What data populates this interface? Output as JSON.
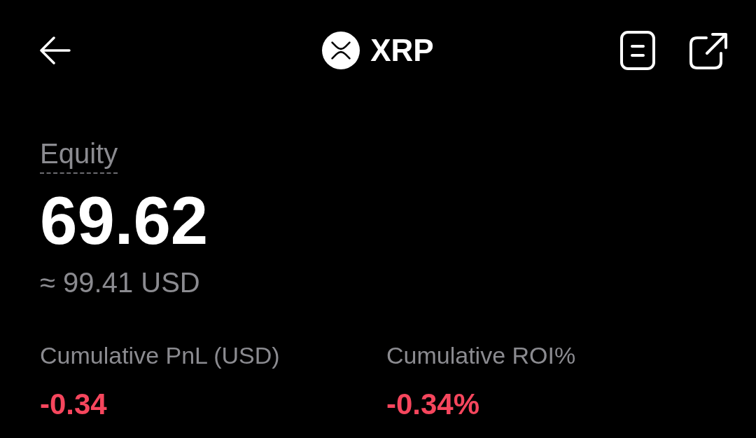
{
  "header": {
    "title": "XRP"
  },
  "equity": {
    "label": "Equity",
    "value": "69.62",
    "approx": "≈ 99.41 USD"
  },
  "stats": [
    {
      "label": "Cumulative PnL (USD)",
      "value": "-0.34",
      "negative": true
    },
    {
      "label": "Cumulative ROI%",
      "value": "-0.34%",
      "negative": true
    }
  ]
}
